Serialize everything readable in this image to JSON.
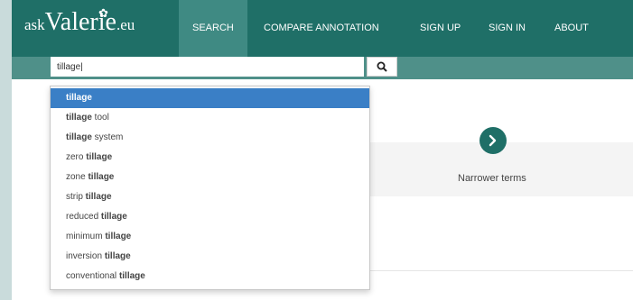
{
  "brand": {
    "prefix": "ask",
    "name": "Valerie",
    "suffix": ".eu"
  },
  "nav": {
    "items": [
      {
        "label": "SEARCH",
        "active": true
      },
      {
        "label": "COMPARE ANNOTATION",
        "active": false
      },
      {
        "label": "SIGN UP",
        "active": false
      },
      {
        "label": "SIGN IN",
        "active": false
      },
      {
        "label": "ABOUT",
        "active": false
      }
    ]
  },
  "search": {
    "value": "tillage|",
    "icon": "search-icon"
  },
  "autocomplete": {
    "selected_index": 0,
    "items": [
      {
        "before": "",
        "match": "tillage",
        "after": ""
      },
      {
        "before": "",
        "match": "tillage",
        "after": " tool"
      },
      {
        "before": "",
        "match": "tillage",
        "after": " system"
      },
      {
        "before": "zero ",
        "match": "tillage",
        "after": ""
      },
      {
        "before": "zone ",
        "match": "tillage",
        "after": ""
      },
      {
        "before": "strip ",
        "match": "tillage",
        "after": ""
      },
      {
        "before": "reduced ",
        "match": "tillage",
        "after": ""
      },
      {
        "before": "minimum ",
        "match": "tillage",
        "after": ""
      },
      {
        "before": "inversion ",
        "match": "tillage",
        "after": ""
      },
      {
        "before": "conventional ",
        "match": "tillage",
        "after": ""
      }
    ]
  },
  "narrower": {
    "label": "Narrower terms",
    "icon": "chevron-right-icon"
  },
  "colors": {
    "primary": "#1f6f67",
    "active_nav": "#3f8a83",
    "search_bar": "#4f9089",
    "selected": "#3a7fc6"
  }
}
